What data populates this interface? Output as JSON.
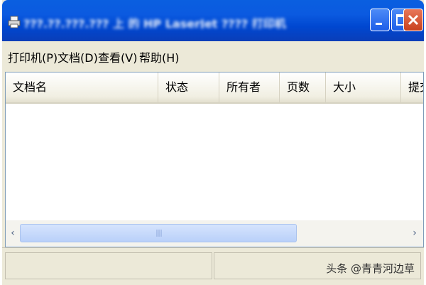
{
  "window": {
    "title": "???.??.???.??? 上 的 HP LaserJet ???? 打印机",
    "icon": "printer-icon",
    "controls": {
      "minimize": "minimize-icon",
      "maximize": "maximize-icon",
      "close": "close-icon"
    }
  },
  "menu": {
    "items": [
      {
        "label": "打印机(P)"
      },
      {
        "label": "文档(D)"
      },
      {
        "label": "查看(V)"
      },
      {
        "label": "帮助(H)"
      }
    ]
  },
  "list": {
    "columns": [
      {
        "label": "文档名"
      },
      {
        "label": "状态"
      },
      {
        "label": "所有者"
      },
      {
        "label": "页数"
      },
      {
        "label": "大小"
      },
      {
        "label": "提交"
      }
    ],
    "rows": []
  },
  "scrollbar": {
    "left_arrow": "‹",
    "right_arrow": "›"
  },
  "watermark": "头条 @青青河边草",
  "colors": {
    "titlebar": "#0a5fe0",
    "close_button": "#c8401e",
    "window_bg": "#ece9d8"
  }
}
